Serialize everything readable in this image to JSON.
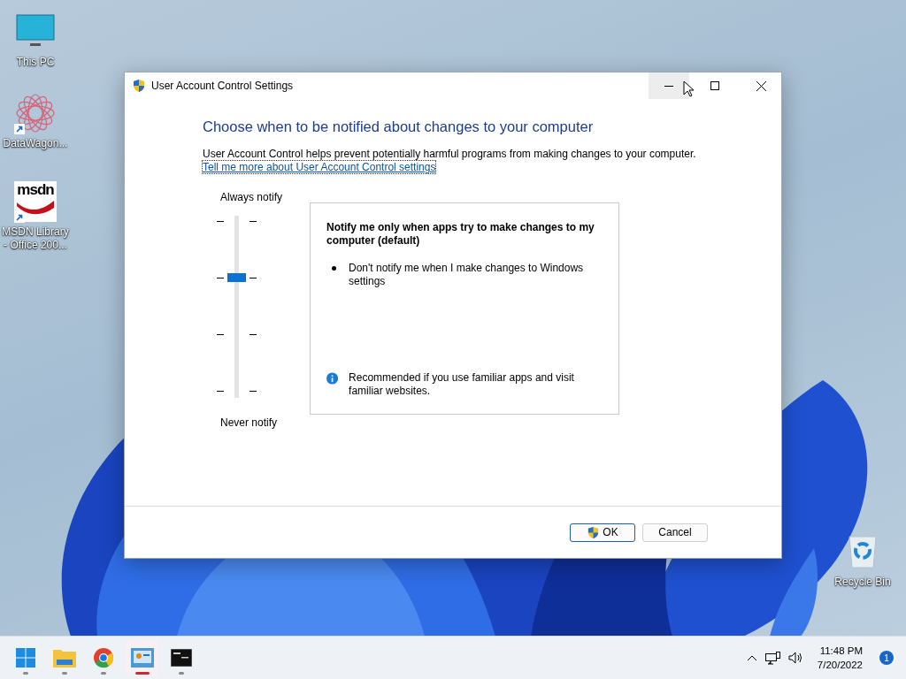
{
  "desktop_icons": [
    {
      "label": "This PC",
      "kind": "pc"
    },
    {
      "label": "DataWagon...",
      "kind": "star",
      "shortcut": true
    },
    {
      "label": "MSDN Library - Office 200...",
      "kind": "msdn",
      "logo_text": "msdn",
      "shortcut": true
    },
    {
      "label": "Recycle Bin",
      "kind": "bin"
    }
  ],
  "window": {
    "title": "User Account Control Settings",
    "caption_buttons": [
      {
        "kind": "minimize",
        "hovered": true
      },
      {
        "kind": "maximize",
        "hovered": false
      },
      {
        "kind": "close",
        "hovered": false
      }
    ],
    "heading": "Choose when to be notified about changes to your computer",
    "description": "User Account Control helps prevent potentially harmful programs from making changes to your computer.",
    "link": "Tell me more about User Account Control settings",
    "slider": {
      "top_label": "Always notify",
      "bottom_label": "Never notify",
      "level": 0.667
    },
    "info_box": {
      "title": "Notify me only when apps try to make changes to my computer (default)",
      "bullets": [
        "Don't notify me when I make changes to Windows settings"
      ],
      "note": "Recommended if you use familiar apps and visit familiar websites."
    },
    "buttons": [
      {
        "label": "OK",
        "kind": "shield",
        "default": true
      },
      {
        "label": "Cancel",
        "kind": "plain",
        "default": false
      }
    ]
  },
  "taskbar": {
    "apps": [
      {
        "kind": "start",
        "selected": false
      },
      {
        "kind": "folder",
        "selected": false
      },
      {
        "kind": "browser",
        "selected": false
      },
      {
        "kind": "control-panel",
        "selected": true
      },
      {
        "kind": "terminal",
        "selected": false
      }
    ],
    "time": "11:48 PM",
    "date": "7/20/2022",
    "notification_count": "1"
  }
}
